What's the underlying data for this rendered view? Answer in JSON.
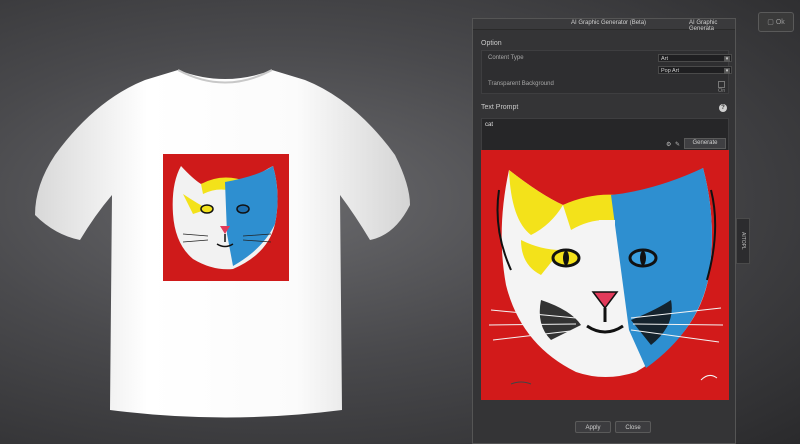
{
  "window": {
    "title": "AI Graphic Generator (Beta)",
    "title_secondary": "AI Graphic Generata"
  },
  "corner_button": {
    "icon": "window-icon",
    "label": "Ok"
  },
  "option": {
    "header": "Option",
    "content_type_label": "Content Type",
    "content_type_value": "Art",
    "style_value": "Pop Art",
    "transparent_bg_label": "Transparent Background",
    "transparent_bg_checkbox_label": "On"
  },
  "prompt": {
    "header": "Text Prompt",
    "help_glyph": "?",
    "value": "cat",
    "generate_label": "Generate"
  },
  "sidebar": {
    "tab_label": "AITOPL"
  },
  "footer": {
    "apply_label": "Apply",
    "close_label": "Close"
  },
  "colors": {
    "accent_red": "#d21a1a",
    "accent_yellow": "#f2e21a",
    "accent_blue": "#2e8fd0",
    "panel_bg": "#343436"
  }
}
